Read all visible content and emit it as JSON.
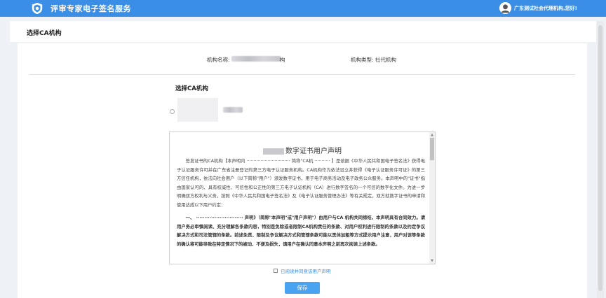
{
  "header": {
    "app_title": "评审专家电子签名服务",
    "user_name": "广东测试社会代理机构,您好!"
  },
  "page": {
    "title": "选择CA机构"
  },
  "org_info": {
    "name_label": "机构名称:",
    "name_suffix": "构",
    "type_label": "机构类型:",
    "type_value": "社代机构"
  },
  "ca_section": {
    "title": "选择CA机构"
  },
  "agreement": {
    "title": "数字证书用户声明",
    "paragraph1": "签发证书的CA机构【本声明内 ······························· 简称\"CA机 ··········· 】是依据《中华人民共和国电子签名法》获得电子认证服务许可并在广东省注册登记的第三方电子认证服务机构。CA机构作为依法设立并获得《电子认证服务许可证》的第三方信任机构，依法向社会用户（以下简称\"用户\"）颁发数字证书，用于电子商务活动及电子政务公众服务。本声明中的\"证书\"指由国家认可的、具有权威性、可信性和公正性的第三方电子认证机构（CA）进行数字签名的一个可信的数字化文件。为进一步明确双方权利与义务，按照《中华人民共和国电子签名法》及《电子认证服务管理办法》等有关规定，双方就数字证书的申请和使用达成以下用户约定：",
    "paragraph2": "一、 ···························· 声明》（简称\"本声明\"或\"用户声明\"）由用户与CA 机构共同缔结，本声明具有合同效力。请用户务必审慎阅读、充分理解各条款内容，特别是免除或者限制CA机构责任的条款、对用户权利进行限制的条款以及约定争议解决方式和司法管辖的条款。前述免责、限制及争议解决方式和管辖条款可能以黑体加粗等方式提示用户注意，用户对该等条款的确认将可能导致在特定情况下的被动、不便及损失，请用户在确认同意本声明之前再次阅读上述条款。"
  },
  "consent": {
    "label": "已阅读并同意该用户声明"
  },
  "actions": {
    "save_label": "保存"
  },
  "colors": {
    "topbar": "#3a8ee6",
    "button": "#4aa3f0"
  }
}
